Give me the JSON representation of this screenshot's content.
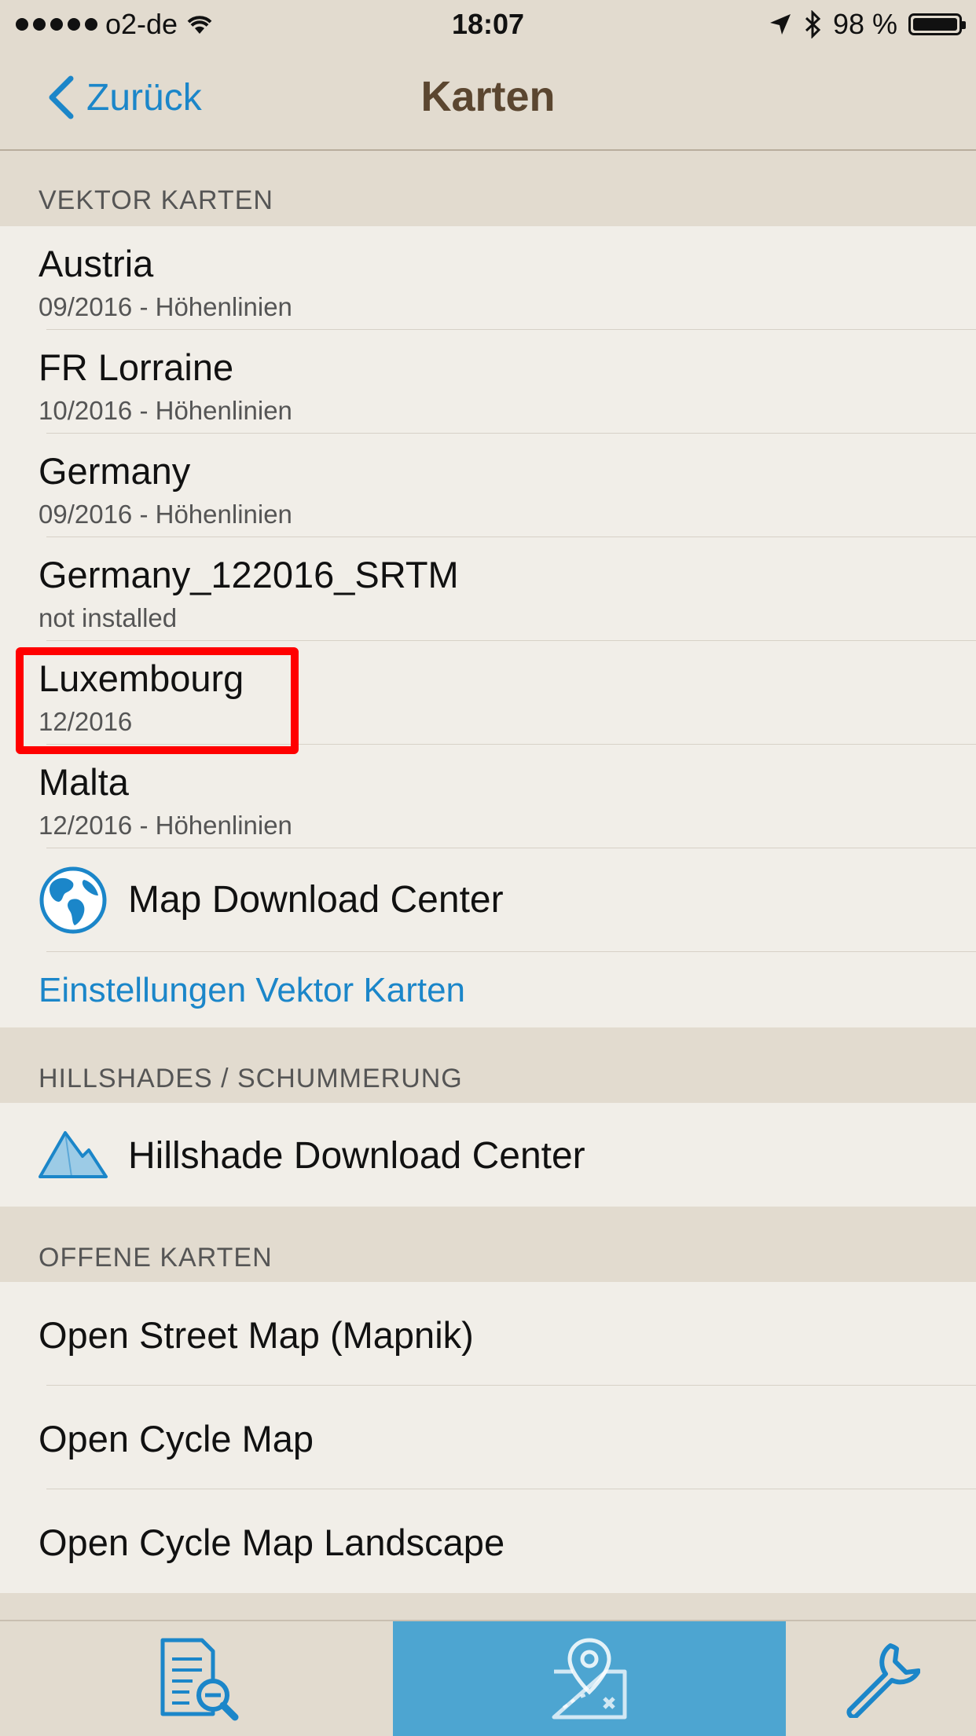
{
  "status_bar": {
    "carrier": "o2-de",
    "time": "18:07",
    "battery": "98 %"
  },
  "nav": {
    "back_label": "Zurück",
    "title": "Karten"
  },
  "sections": {
    "vector": {
      "header": "VEKTOR KARTEN",
      "items": [
        {
          "title": "Austria",
          "subtitle": "09/2016  -  Höhenlinien"
        },
        {
          "title": "FR Lorraine",
          "subtitle": "10/2016  -  Höhenlinien"
        },
        {
          "title": "Germany",
          "subtitle": "09/2016  -  Höhenlinien"
        },
        {
          "title": "Germany_122016_SRTM",
          "subtitle": "not installed"
        },
        {
          "title": "Luxembourg",
          "subtitle": "12/2016"
        },
        {
          "title": "Malta",
          "subtitle": "12/2016  -  Höhenlinien"
        }
      ],
      "download_center": "Map Download Center",
      "settings_link": "Einstellungen Vektor Karten"
    },
    "hillshades": {
      "header": "HILLSHADES / SCHUMMERUNG",
      "download_center": "Hillshade Download Center"
    },
    "open_maps": {
      "header": "OFFENE KARTEN",
      "items": [
        "Open Street Map (Mapnik)",
        "Open Cycle Map",
        "Open Cycle Map Landscape"
      ]
    }
  },
  "colors": {
    "accent": "#1b86c9",
    "tab_active": "#4da5d1",
    "title": "#5b4630",
    "highlight": "#ff0000"
  },
  "icons": {
    "globe": "globe-icon",
    "mountain": "mountain-icon",
    "search_doc": "document-search-icon",
    "map_pin": "map-pin-icon",
    "wrench": "wrench-icon"
  }
}
